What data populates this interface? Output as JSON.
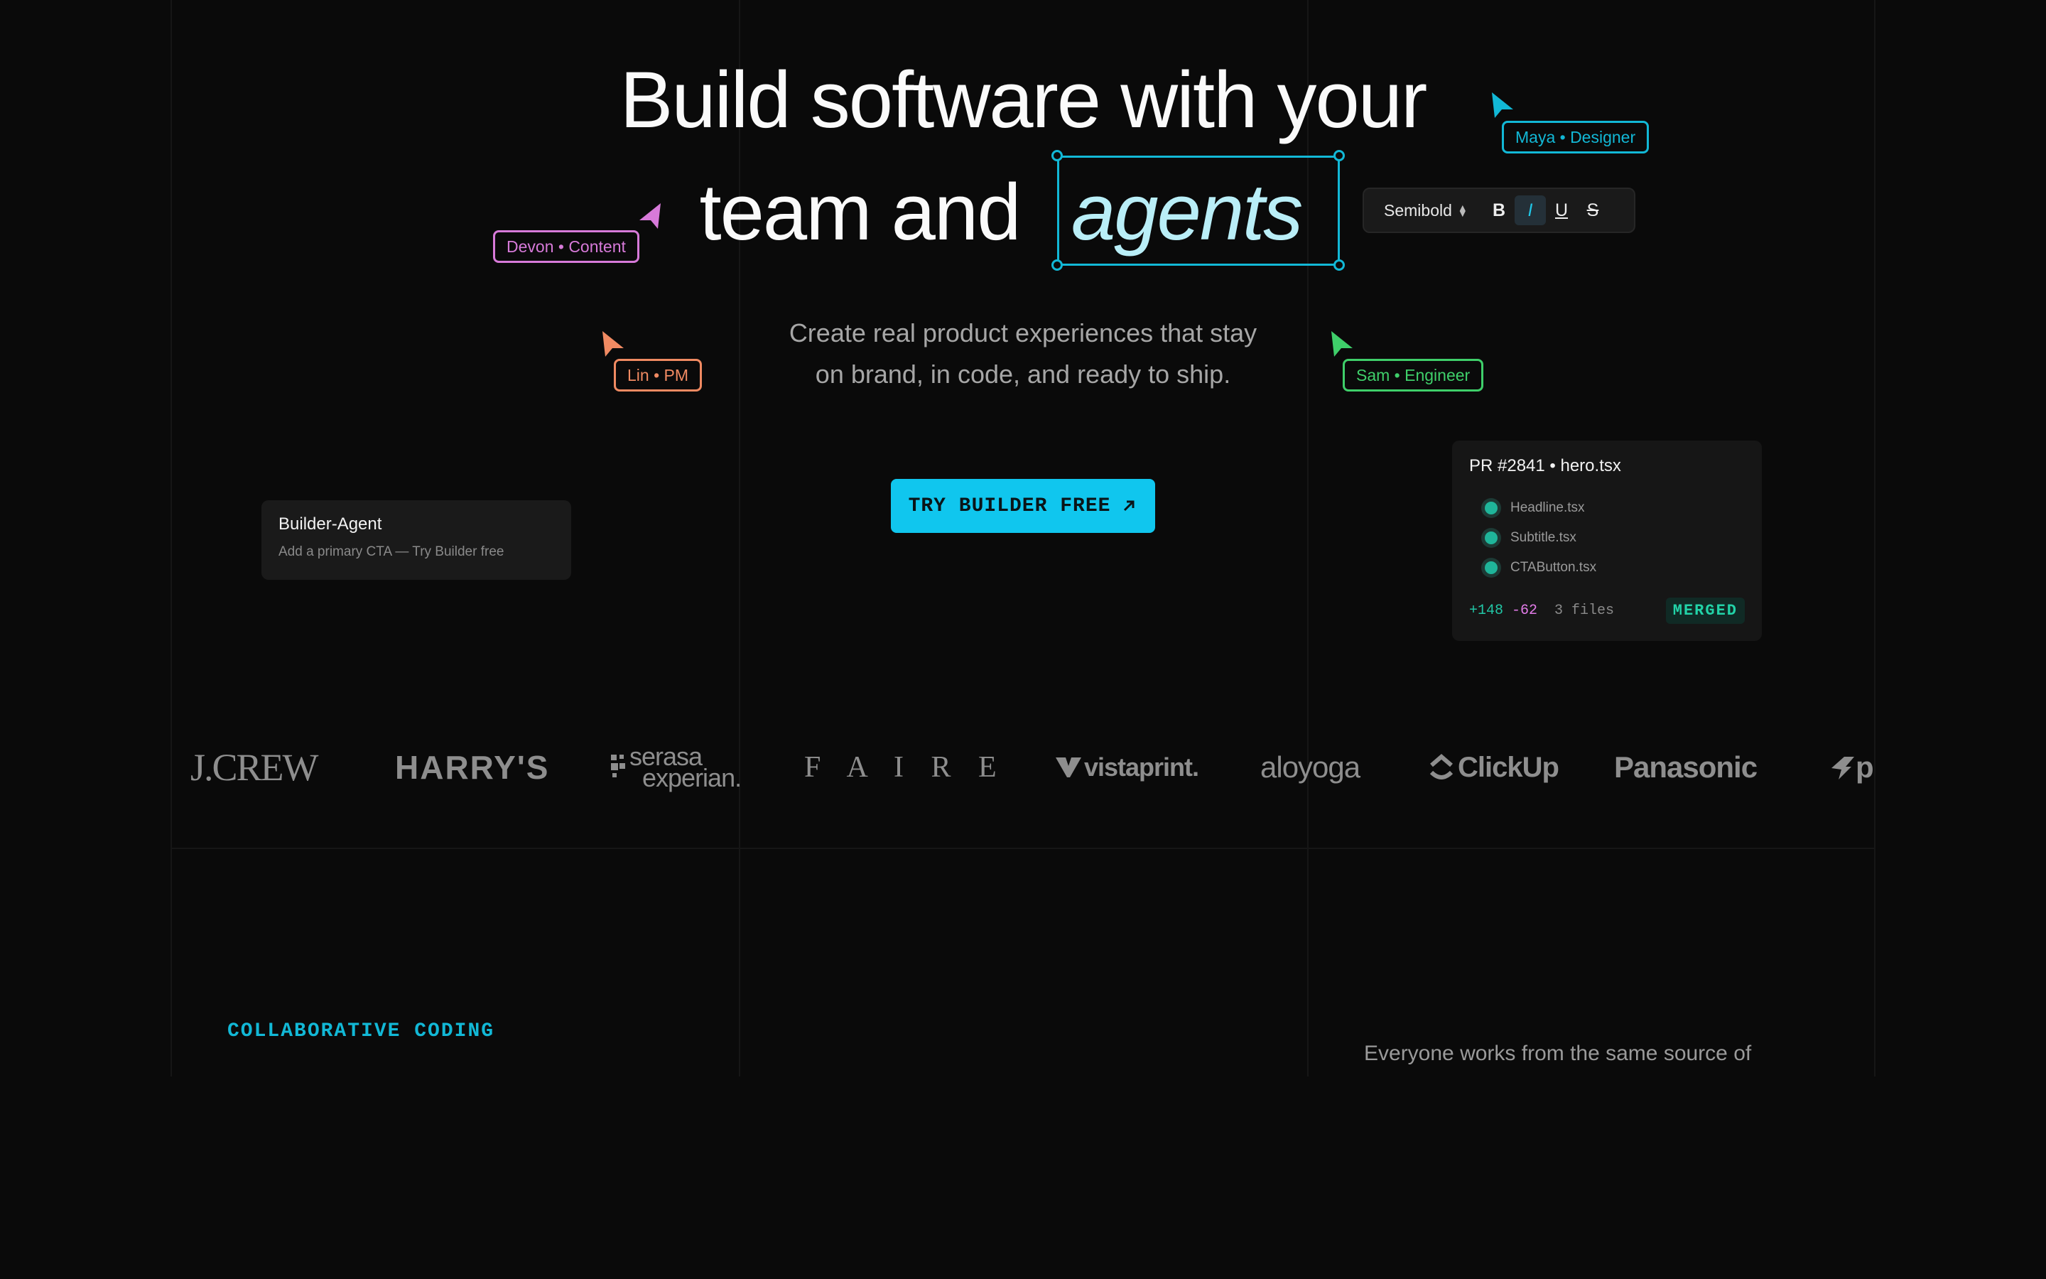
{
  "hero": {
    "headline_line1": "Build software with your",
    "headline_line2_prefix": "team and",
    "headline_highlight": "agents",
    "subtitle_line1": "Create real product experiences that stay",
    "subtitle_line2": "on brand, in code, and ready to ship.",
    "cta_label": "TRY BUILDER FREE",
    "cta_icon": "arrow-up-right-icon"
  },
  "format_toolbar": {
    "font_weight": "Semibold",
    "bold": "B",
    "italic": "I",
    "underline": "U",
    "strike": "S"
  },
  "collaborators": [
    {
      "label": "Maya • Designer",
      "color": "#12b8d6"
    },
    {
      "label": "Devon • Content",
      "color": "#d77ad9"
    },
    {
      "label": "Lin • PM",
      "color": "#f08a62"
    },
    {
      "label": "Sam • Engineer",
      "color": "#3fcf6a"
    }
  ],
  "agent_card": {
    "title": "Builder-Agent",
    "description": "Add a primary CTA — Try Builder free"
  },
  "pr_card": {
    "title": "PR #2841 • hero.tsx",
    "files": [
      "Headline.tsx",
      "Subtitle.tsx",
      "CTAButton.tsx"
    ],
    "additions": "+148",
    "deletions": "-62",
    "file_count": "3 files",
    "status": "MERGED"
  },
  "logos": [
    "J.CREW",
    "HARRY'S",
    "serasa",
    "experian.",
    "F A I R E",
    "vistaprint.",
    "aloyoga",
    "ClickUp",
    "Panasonic",
    "p"
  ],
  "section": {
    "eyebrow": "COLLABORATIVE CODING",
    "right_copy": "Everyone works from the same source of"
  }
}
